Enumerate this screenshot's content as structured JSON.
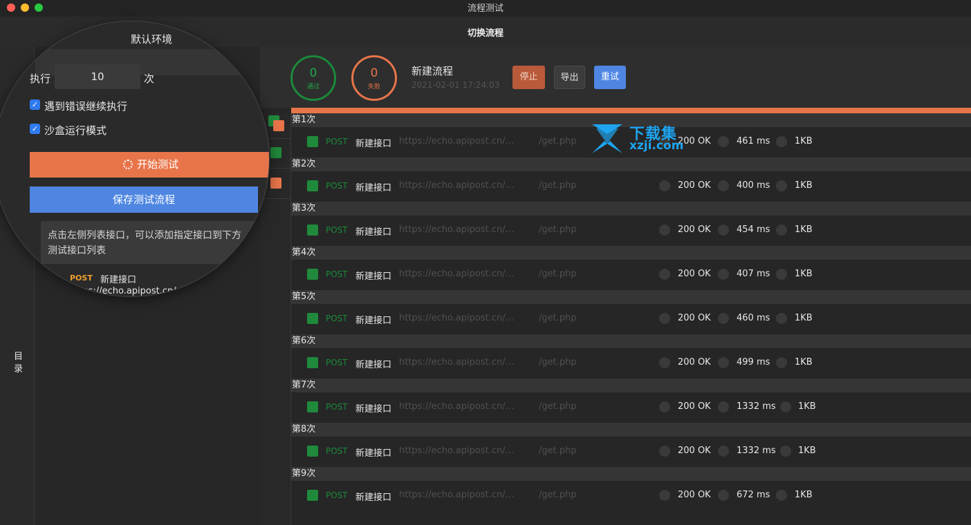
{
  "window": {
    "title": "流程测试"
  },
  "topbar": {
    "title": "切换流程"
  },
  "sidebar": {
    "label": "目录"
  },
  "config": {
    "env_name": "默认环境",
    "exec_label": "执行",
    "exec_count": "10",
    "exec_unit": "次",
    "continue_on_error_label": "遇到错误继续执行",
    "sandbox_label": "沙盒运行模式",
    "start_label": "开始测试",
    "save_label": "保存测试流程",
    "tip": "点击左侧列表接口，可以添加指定接口到下方测试接口列表",
    "api_list": [
      {
        "method": "POST",
        "name": "新建接口",
        "url": "https://echo.apipost.cn/get.php"
      }
    ]
  },
  "summary": {
    "pass_count": "0",
    "pass_label": "通过",
    "fail_count": "0",
    "fail_label": "失败",
    "flow_name": "新建流程",
    "flow_time": "2021-02-01 17:24:03",
    "stop_label": "停止",
    "export_label": "导出",
    "retry_label": "重试"
  },
  "runs": [
    {
      "label": "第1次",
      "method": "POST",
      "name": "新建接口",
      "url": "https://echo.apipost.cn/…",
      "path": "/get.php",
      "status": "200 OK",
      "time": "461 ms",
      "size": "1KB"
    },
    {
      "label": "第2次",
      "method": "POST",
      "name": "新建接口",
      "url": "https://echo.apipost.cn/…",
      "path": "/get.php",
      "status": "200 OK",
      "time": "400 ms",
      "size": "1KB"
    },
    {
      "label": "第3次",
      "method": "POST",
      "name": "新建接口",
      "url": "https://echo.apipost.cn/…",
      "path": "/get.php",
      "status": "200 OK",
      "time": "454 ms",
      "size": "1KB"
    },
    {
      "label": "第4次",
      "method": "POST",
      "name": "新建接口",
      "url": "https://echo.apipost.cn/…",
      "path": "/get.php",
      "status": "200 OK",
      "time": "407 ms",
      "size": "1KB"
    },
    {
      "label": "第5次",
      "method": "POST",
      "name": "新建接口",
      "url": "https://echo.apipost.cn/…",
      "path": "/get.php",
      "status": "200 OK",
      "time": "460 ms",
      "size": "1KB"
    },
    {
      "label": "第6次",
      "method": "POST",
      "name": "新建接口",
      "url": "https://echo.apipost.cn/…",
      "path": "/get.php",
      "status": "200 OK",
      "time": "499 ms",
      "size": "1KB"
    },
    {
      "label": "第7次",
      "method": "POST",
      "name": "新建接口",
      "url": "https://echo.apipost.cn/…",
      "path": "/get.php",
      "status": "200 OK",
      "time": "1332 ms",
      "size": "1KB"
    },
    {
      "label": "第8次",
      "method": "POST",
      "name": "新建接口",
      "url": "https://echo.apipost.cn/…",
      "path": "/get.php",
      "status": "200 OK",
      "time": "1332 ms",
      "size": "1KB"
    },
    {
      "label": "第9次",
      "method": "POST",
      "name": "新建接口",
      "url": "https://echo.apipost.cn/…",
      "path": "/get.php",
      "status": "200 OK",
      "time": "672 ms",
      "size": "1KB"
    }
  ],
  "watermark": {
    "brand_cn": "下载集",
    "brand_en": "xzji.com"
  },
  "colors": {
    "pass": "#1fa84a",
    "fail": "#e8754a",
    "primary": "#4e86e2"
  }
}
